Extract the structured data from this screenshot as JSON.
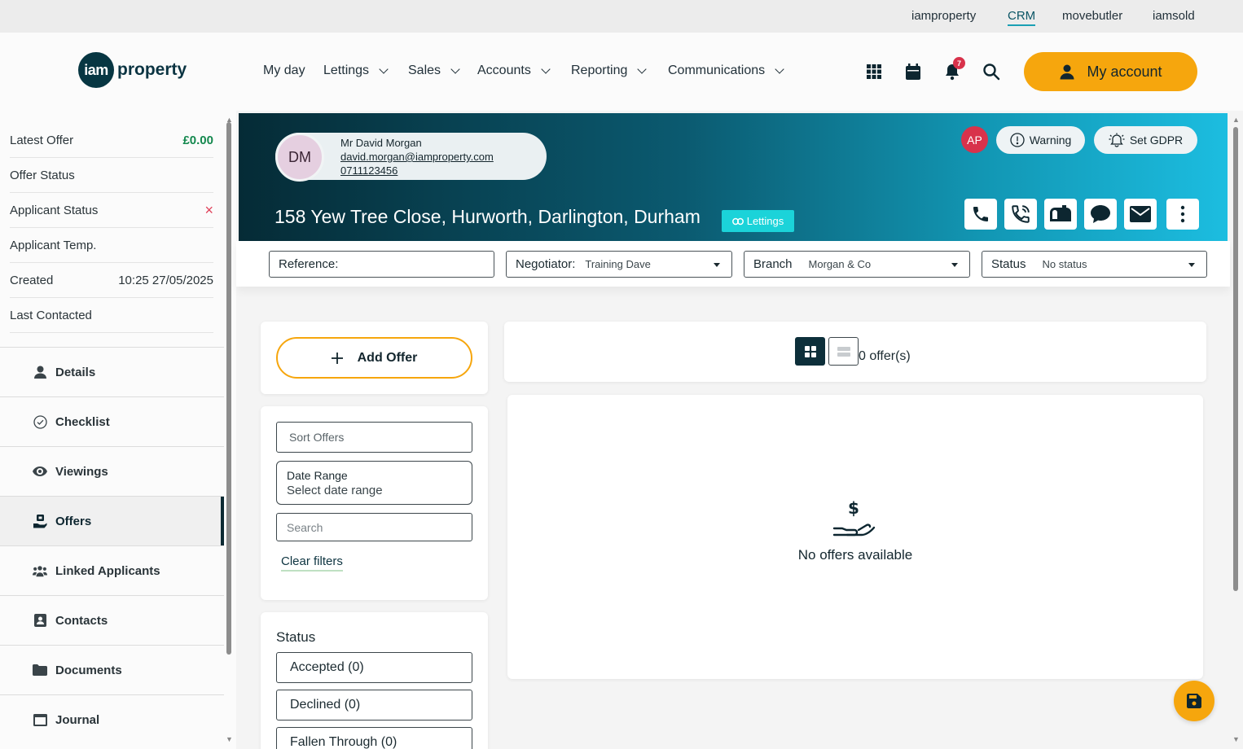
{
  "brand_links": [
    "iamproperty",
    "CRM",
    "movebutler",
    "iamsold"
  ],
  "logo": {
    "mark": "iam",
    "text": "property"
  },
  "nav": {
    "my_day": "My day",
    "lettings": "Lettings",
    "sales": "Sales",
    "accounts": "Accounts",
    "reporting": "Reporting",
    "communications": "Communications",
    "notifications_count": "7",
    "my_account": "My account"
  },
  "summary": {
    "latest_offer_label": "Latest Offer",
    "latest_offer_value": "£0.00",
    "offer_status_label": "Offer Status",
    "applicant_status_label": "Applicant Status",
    "applicant_status_value": "×",
    "applicant_temp_label": "Applicant Temp.",
    "created_label": "Created",
    "created_value": "10:25 27/05/2025",
    "last_contacted_label": "Last Contacted"
  },
  "sidebar_items": [
    "Details",
    "Checklist",
    "Viewings",
    "Offers",
    "Linked Applicants",
    "Contacts",
    "Documents",
    "Journal"
  ],
  "contact": {
    "initials": "DM",
    "name": "Mr David Morgan",
    "email": "david.morgan@iamproperty.com",
    "phone": "0711123456"
  },
  "property": {
    "address": "158 Yew Tree Close, Hurworth, Darlington, Durham",
    "tag": "Lettings"
  },
  "header_actions": {
    "user_initials": "AP",
    "warning_label": "Warning",
    "gdpr_label": "Set GDPR"
  },
  "filters": {
    "reference_label": "Reference:",
    "negotiator_label": "Negotiator:",
    "negotiator_value": "Training Dave",
    "branch_label": "Branch",
    "branch_value": "Morgan & Co",
    "status_label": "Status",
    "status_value": "No status"
  },
  "offers_panel": {
    "add_offer": "Add Offer",
    "sort_placeholder": "Sort Offers",
    "date_range_label": "Date Range",
    "date_range_placeholder": "Select date range",
    "search_placeholder": "Search",
    "clear_filters": "Clear filters",
    "status_title": "Status",
    "status_options": [
      "Accepted (0)",
      "Declined (0)",
      "Fallen Through (0)"
    ]
  },
  "offers_list": {
    "count_text": "0 offer(s)",
    "empty_text": "No offers available"
  },
  "colors": {
    "accent": "#f6a60d",
    "dark": "#073642",
    "teal": "#1bd3d9",
    "alert": "#d8324b",
    "success": "#14884e"
  }
}
